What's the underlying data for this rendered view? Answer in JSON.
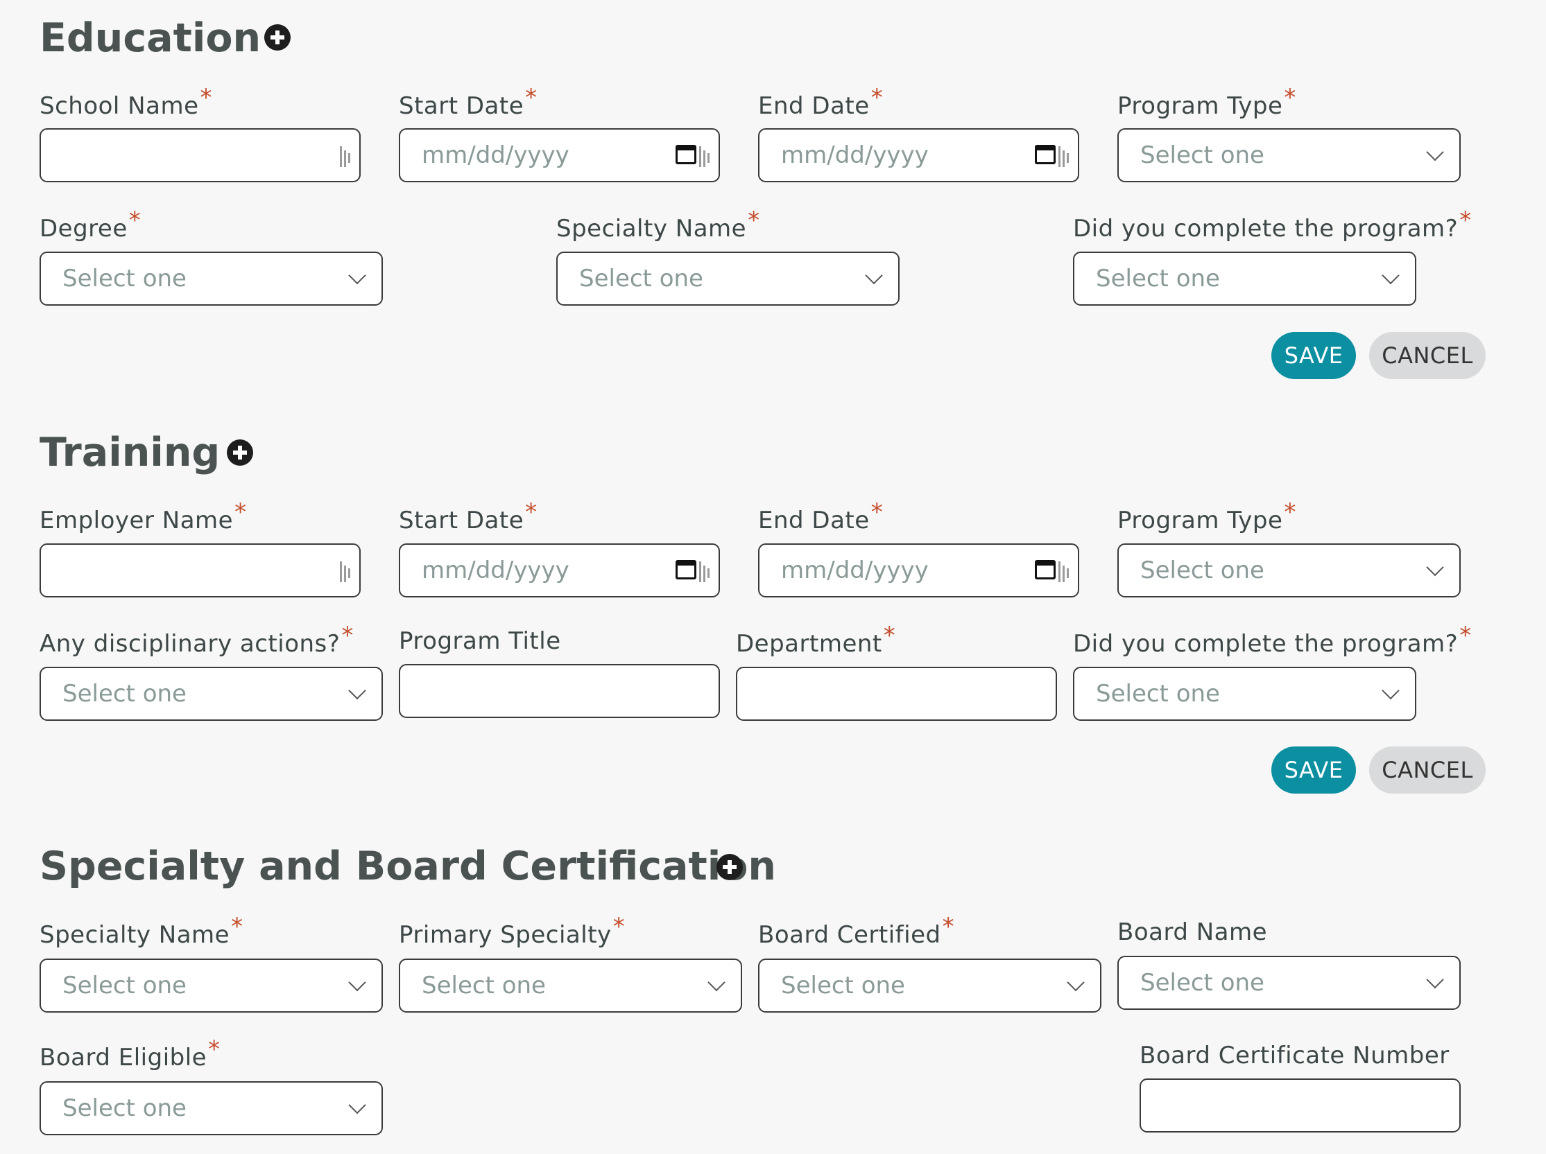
{
  "education": {
    "title": "Education",
    "school_name_label": "School Name",
    "start_date_label": "Start Date",
    "start_date_placeholder": "mm/dd/yyyy",
    "end_date_label": "End Date",
    "end_date_placeholder": "mm/dd/yyyy",
    "program_type_label": "Program Type",
    "program_type_placeholder": "Select one",
    "degree_label": "Degree",
    "degree_placeholder": "Select one",
    "specialty_name_label": "Specialty Name",
    "specialty_name_placeholder": "Select one",
    "completed_label": "Did you complete the program?",
    "completed_placeholder": "Select one",
    "save_label": "SAVE",
    "cancel_label": "CANCEL"
  },
  "training": {
    "title": "Training",
    "employer_name_label": "Employer Name",
    "start_date_label": "Start Date",
    "start_date_placeholder": "mm/dd/yyyy",
    "end_date_label": "End Date",
    "end_date_placeholder": "mm/dd/yyyy",
    "program_type_label": "Program Type",
    "program_type_placeholder": "Select one",
    "disciplinary_label": "Any disciplinary actions?",
    "disciplinary_placeholder": "Select one",
    "program_title_label": "Program Title",
    "department_label": "Department",
    "completed_label": "Did you complete the program?",
    "completed_placeholder": "Select one",
    "save_label": "SAVE",
    "cancel_label": "CANCEL"
  },
  "certification": {
    "title": "Specialty and Board Certification",
    "specialty_name_label": "Specialty Name",
    "specialty_name_placeholder": "Select one",
    "primary_specialty_label": "Primary Specialty",
    "primary_specialty_placeholder": "Select one",
    "board_certified_label": "Board Certified",
    "board_certified_placeholder": "Select one",
    "board_name_label": "Board Name",
    "board_name_placeholder": "Select one",
    "board_eligible_label": "Board Eligible",
    "board_eligible_placeholder": "Select one",
    "board_cert_number_label": "Board Certificate Number"
  },
  "required_marker": "*",
  "colors": {
    "accent": "#0b8fa1",
    "required": "#c5502f",
    "cancel_bg": "#d9dadb",
    "page_bg": "#f7f7f7"
  }
}
